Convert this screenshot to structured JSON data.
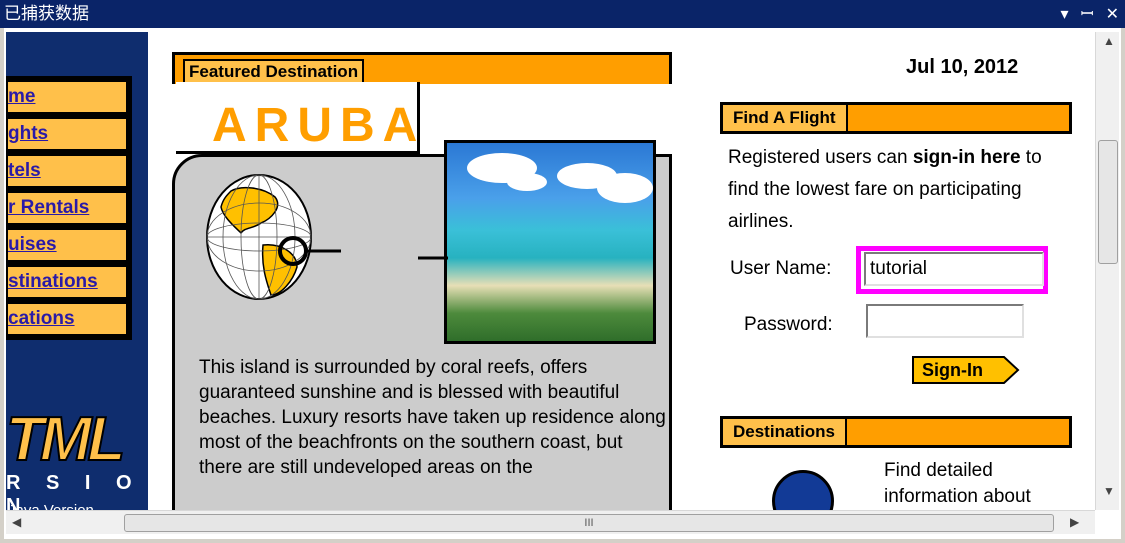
{
  "window": {
    "title": "已捕获数据",
    "controls": [
      "▾",
      "ꟷ",
      "✕"
    ]
  },
  "nav": {
    "items": [
      {
        "label": "me"
      },
      {
        "label": "ghts"
      },
      {
        "label": "tels"
      },
      {
        "label": "r Rentals"
      },
      {
        "label": "uises"
      },
      {
        "label": "stinations"
      },
      {
        "label": "cations"
      }
    ]
  },
  "logo": {
    "main": "TML",
    "sub": "R S I O N",
    "note": "Java Version"
  },
  "featured": {
    "label": "Featured Destination",
    "place": "ARUBA",
    "description": "This island is surrounded by coral reefs, offers guaranteed sunshine and is blessed with beautiful beaches. Luxury resorts have taken up residence along most of the beachfronts on the southern coast, but there are still undeveloped areas on the"
  },
  "date": "Jul 10, 2012",
  "find_flight": {
    "label": "Find A Flight",
    "text_pre": "Registered users can ",
    "text_bold": "sign-in here",
    "text_post": " to find the lowest fare on participating airlines.",
    "username_label": "User Name:",
    "username_value": "tutorial",
    "password_label": "Password:",
    "password_value": "",
    "signin_label": "Sign-In"
  },
  "destinations": {
    "label": "Destinations",
    "text": "Find detailed information about"
  },
  "scrollbar": {
    "h_grip": "III"
  }
}
